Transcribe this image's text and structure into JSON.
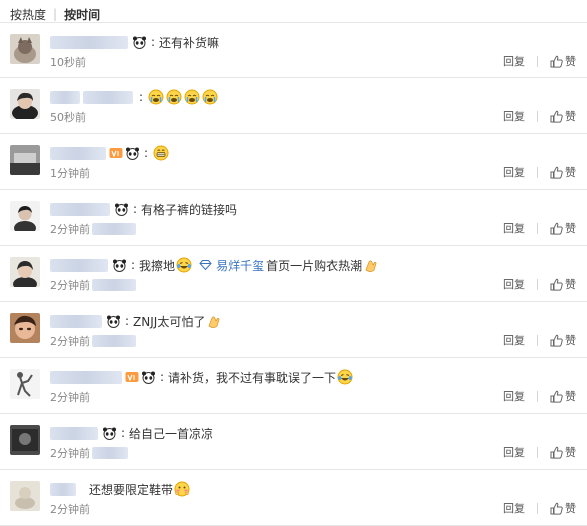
{
  "sort": {
    "hot": "按热度",
    "time": "按时间"
  },
  "reply_label": "回复",
  "like_label": "赞",
  "comments": [
    {
      "text": "还有补货嘛",
      "time": "10秒前"
    },
    {
      "text": "",
      "time": "50秒前"
    },
    {
      "text": "",
      "time": "1分钟前"
    },
    {
      "text": "有格子裤的链接吗",
      "time": "2分钟前"
    },
    {
      "text": "我擦地",
      "mention": "易烊千玺",
      "text2": "首页一片购衣热潮",
      "time": "2分钟前"
    },
    {
      "text": "ZNJJ太可怕了",
      "time": "2分钟前"
    },
    {
      "text": "请补货，我不过有事耽误了一下",
      "time": "2分钟前"
    },
    {
      "text": "给自己一首凉凉",
      "time": "2分钟前"
    },
    {
      "text": "还想要限定鞋带",
      "time": "2分钟前"
    }
  ]
}
